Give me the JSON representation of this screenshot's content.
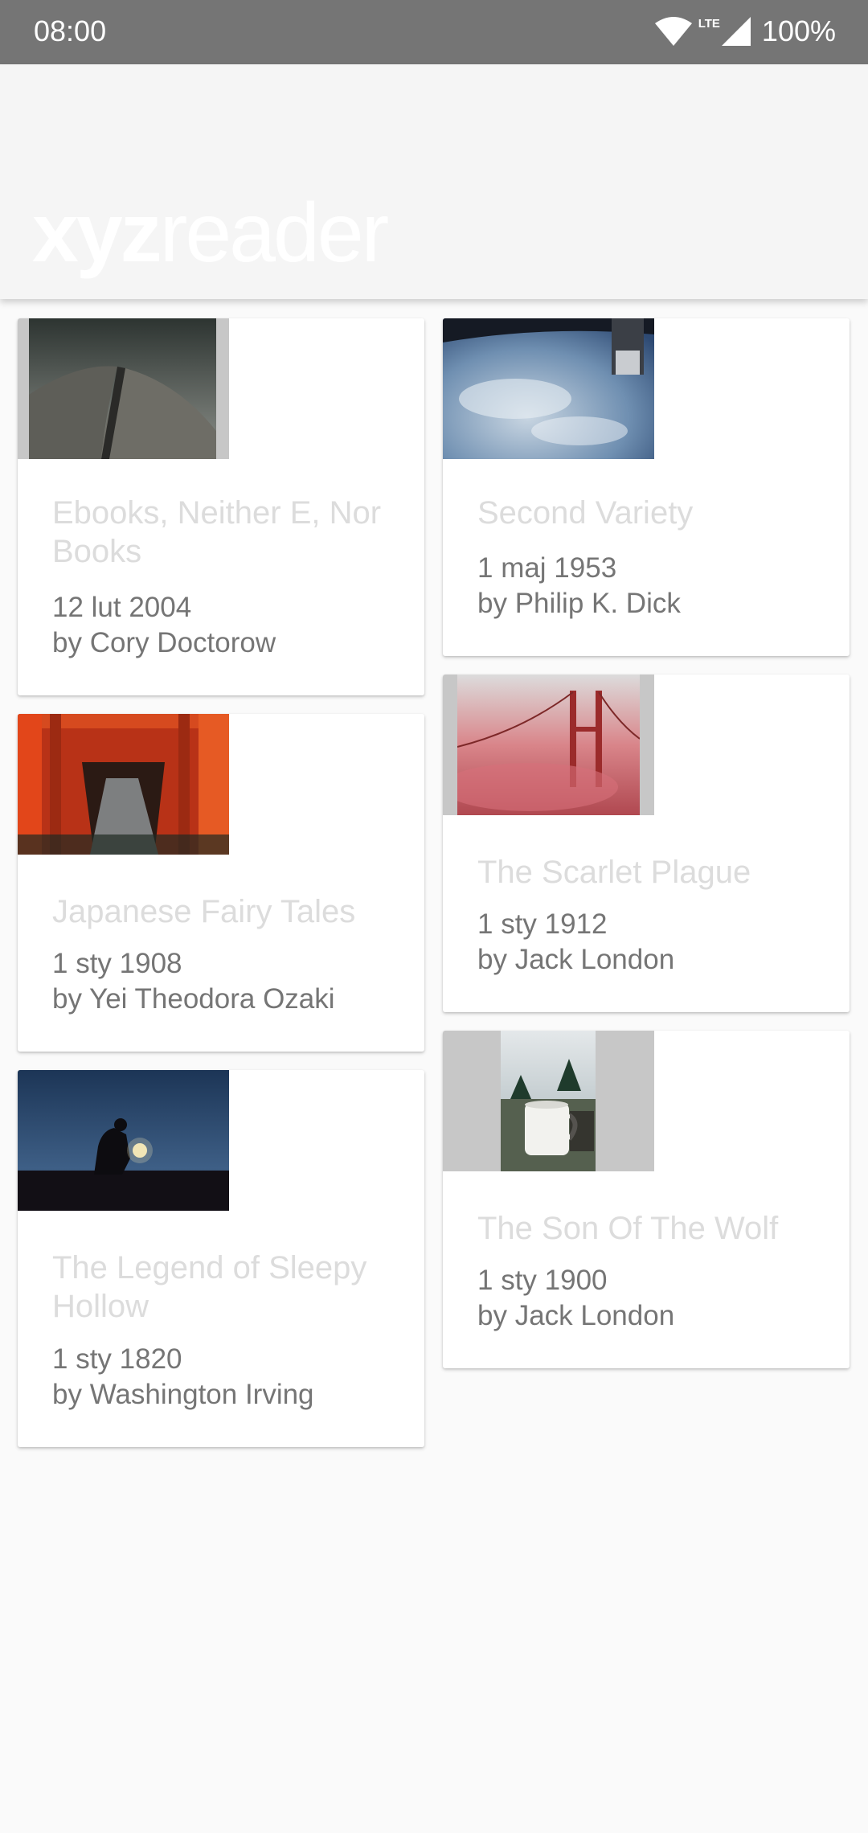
{
  "status_bar": {
    "time": "08:00",
    "network": "LTE",
    "battery": "100%",
    "icons": [
      "wifi-icon",
      "signal-icon"
    ]
  },
  "app_bar": {
    "logo_bold": "xyz",
    "logo_light": "reader"
  },
  "articles": [
    {
      "title": "Ebooks, Neither E, Nor Books",
      "date": "12 lut 2004",
      "author": "by Cory Doctorow",
      "image": "opera-house-roof"
    },
    {
      "title": "Second Variety",
      "date": "1 maj 1953",
      "author": "by Philip K. Dick",
      "image": "earth-from-space"
    },
    {
      "title": "Japanese Fairy Tales",
      "date": "1 sty 1908",
      "author": "by Yei Theodora Ozaki",
      "image": "torii-gates"
    },
    {
      "title": "The Scarlet Plague",
      "date": "1 sty 1912",
      "author": "by Jack London",
      "image": "bridge-in-red-fog"
    },
    {
      "title": "The Legend of Sleepy Hollow",
      "date": "1 sty 1820",
      "author": "by Washington Irving",
      "image": "figure-with-lantern"
    },
    {
      "title": "The Son Of The Wolf",
      "date": "1 sty 1900",
      "author": "by Jack London",
      "image": "camping-mug"
    }
  ]
}
